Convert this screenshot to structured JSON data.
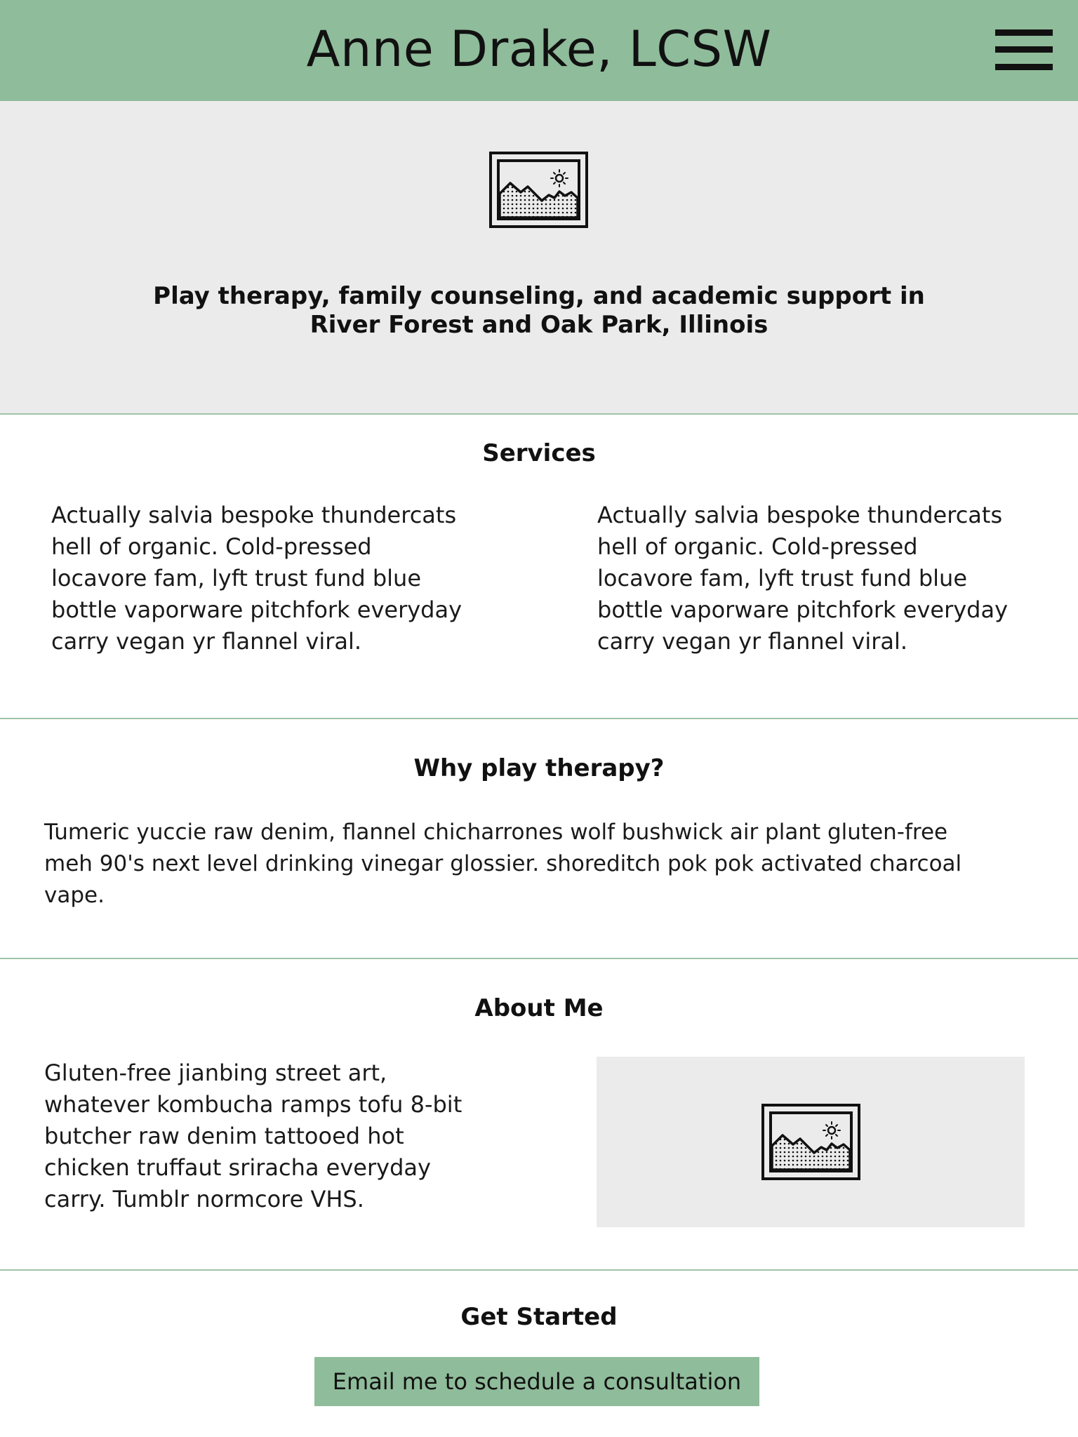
{
  "header": {
    "title": "Anne Drake, LCSW",
    "menu_icon": "hamburger-menu-icon",
    "background_color": "#8fbc9a"
  },
  "hero": {
    "image_icon": "image-placeholder-icon",
    "tagline_line1": "Play therapy, family counseling, and academic support in",
    "tagline_line2": "River Forest and Oak Park, Illinois",
    "background_color": "#ebebeb"
  },
  "services": {
    "title": "Services",
    "columns": [
      {
        "lines": [
          "Actually salvia bespoke thundercats",
          "hell of organic. Cold-pressed",
          "locavore fam, lyft trust fund blue",
          "bottle vaporware pitchfork everyday",
          "carry vegan yr flannel viral."
        ]
      },
      {
        "lines": [
          "Actually salvia bespoke thundercats",
          "hell of organic. Cold-pressed",
          "locavore fam, lyft trust fund blue",
          "bottle vaporware pitchfork everyday",
          "carry vegan yr flannel viral."
        ]
      }
    ]
  },
  "why_play": {
    "title": "Why play therapy?",
    "lines": [
      "Tumeric yuccie raw denim, flannel chicharrones wolf bushwick air plant gluten-free",
      "meh 90's next level drinking vinegar glossier. shoreditch pok pok activated charcoal",
      "vape."
    ]
  },
  "about": {
    "title": "About Me",
    "lines": [
      "Gluten-free jianbing street art,",
      "whatever kombucha ramps tofu 8-bit",
      "butcher raw denim tattooed hot",
      "chicken truffaut sriracha everyday",
      "carry. Tumblr normcore VHS."
    ],
    "image_icon": "image-placeholder-icon"
  },
  "get_started": {
    "title": "Get Started",
    "button_label": "Email me to schedule a consultation",
    "button_color": "#8fbc9a"
  },
  "colors": {
    "accent": "#8fbc9a",
    "divider": "#9fc4a8",
    "placeholder_bg": "#ebebeb"
  }
}
